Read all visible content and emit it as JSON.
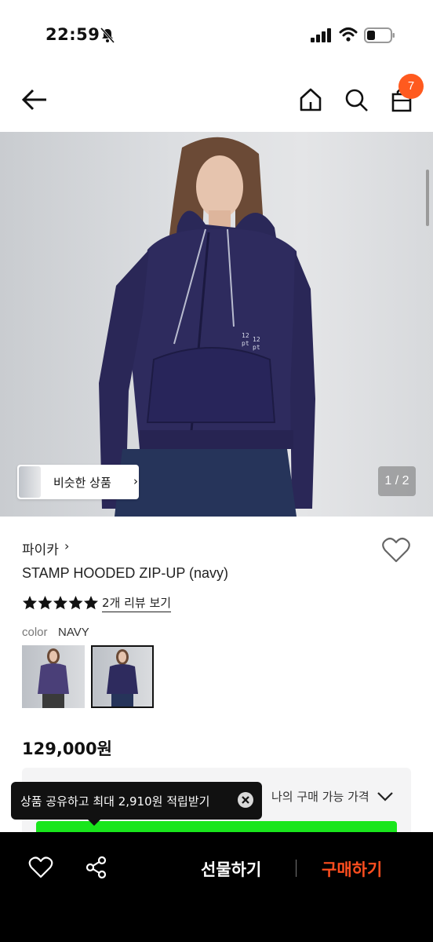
{
  "status_bar": {
    "time": "22:59"
  },
  "nav": {
    "cart_count": "7"
  },
  "hero": {
    "similar_label": "비슷한 상품",
    "similar_chevron": "›",
    "page_indicator": "1 / 2",
    "print_text": [
      "12",
      "pt",
      "12",
      "pt"
    ]
  },
  "product": {
    "brand": "파이카",
    "brand_chevron": "›",
    "name": "STAMP HOODED ZIP-UP (navy)",
    "rating": 5,
    "review_link": "2개 리뷰 보기",
    "color_label": "color",
    "color_value": "NAVY",
    "price": "129,000원"
  },
  "price_panel": {
    "my_price_label": "나의 구매 가능 가격"
  },
  "tooltip": {
    "text": "상품 공유하고 최대 2,910원 적립받기"
  },
  "bottom_bar": {
    "gift_label": "선물하기",
    "buy_label": "구매하기"
  },
  "colors": {
    "accent": "#ff5a1f",
    "buy": "#ff4e1f",
    "garment": "#2e2b5e",
    "green": "#19e61c"
  },
  "icons": [
    "bell-slash-icon",
    "signal-icon",
    "wifi-icon",
    "battery-icon",
    "back-arrow-icon",
    "home-icon",
    "search-icon",
    "cart-icon",
    "heart-icon",
    "star-icon",
    "chevron-down-icon",
    "close-icon",
    "share-icon"
  ]
}
